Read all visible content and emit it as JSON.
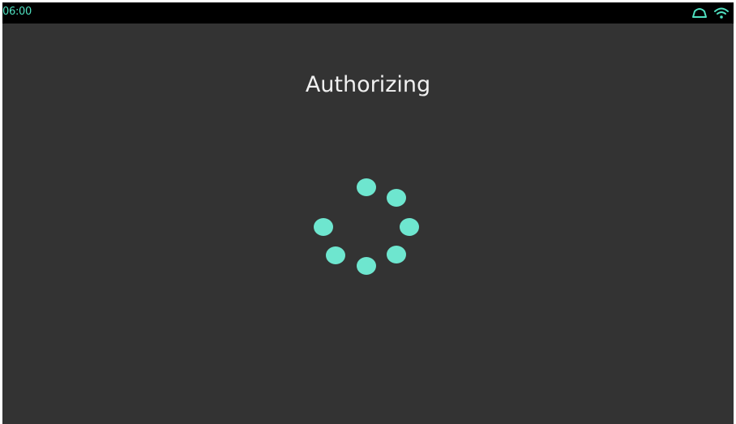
{
  "status_bar": {
    "time": "06:00",
    "accent_color": "#4fe0c0",
    "icons": [
      "cloud-icon",
      "wifi-icon"
    ]
  },
  "main": {
    "title": "Authorizing",
    "spinner": {
      "icon": "loading-spinner-icon",
      "dot_color": "#6ee6cf",
      "dot_count": 7
    }
  }
}
